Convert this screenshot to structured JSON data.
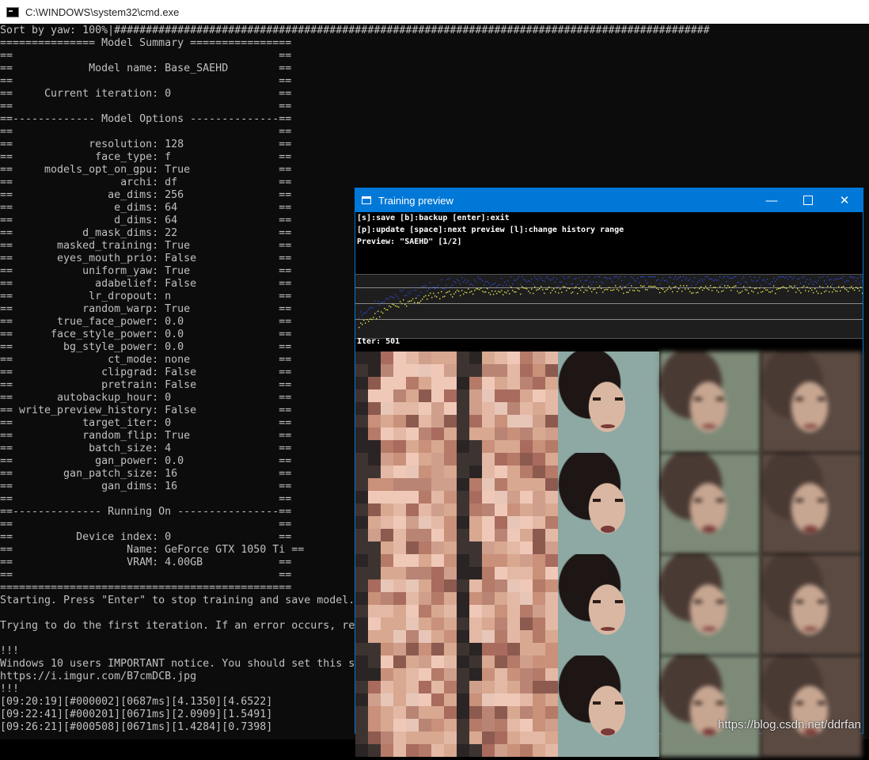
{
  "cmd": {
    "title": "C:\\WINDOWS\\system32\\cmd.exe",
    "lines": [
      "Sort by yaw: 100%|##############################################################################################",
      "=============== Model Summary ================",
      "==                                          ==",
      "==            Model name: Base_SAEHD        ==",
      "==                                          ==",
      "==     Current iteration: 0                 ==",
      "==                                          ==",
      "==------------- Model Options --------------==",
      "==                                          ==",
      "==            resolution: 128               ==",
      "==             face_type: f                 ==",
      "==     models_opt_on_gpu: True              ==",
      "==                 archi: df                ==",
      "==               ae_dims: 256               ==",
      "==                e_dims: 64                ==",
      "==                d_dims: 64                ==",
      "==           d_mask_dims: 22                ==",
      "==       masked_training: True              ==",
      "==       eyes_mouth_prio: False             ==",
      "==           uniform_yaw: True              ==",
      "==             adabelief: False             ==",
      "==            lr_dropout: n                 ==",
      "==           random_warp: True              ==",
      "==       true_face_power: 0.0               ==",
      "==      face_style_power: 0.0               ==",
      "==        bg_style_power: 0.0               ==",
      "==               ct_mode: none              ==",
      "==              clipgrad: False             ==",
      "==              pretrain: False             ==",
      "==       autobackup_hour: 0                 ==",
      "== write_preview_history: False             ==",
      "==           target_iter: 0                 ==",
      "==           random_flip: True              ==",
      "==            batch_size: 4                 ==",
      "==             gan_power: 0.0               ==",
      "==        gan_patch_size: 16                ==",
      "==              gan_dims: 16                ==",
      "==                                          ==",
      "==-------------- Running On ----------------==",
      "==                                          ==",
      "==          Device index: 0                 ==",
      "==                  Name: GeForce GTX 1050 Ti ==",
      "==                  VRAM: 4.00GB            ==",
      "==                                          ==",
      "==============================================",
      "Starting. Press \"Enter\" to stop training and save model.",
      "",
      "Trying to do the first iteration. If an error occurs, re",
      "",
      "!!!",
      "Windows 10 users IMPORTANT notice. You should set this s",
      "https://i.imgur.com/B7cmDCB.jpg",
      "!!!",
      "[09:20:19][#000002][0687ms][4.1350][4.6522]",
      "[09:22:41][#000201][0671ms][2.0909][1.5491]",
      "[09:26:21][#000508][0671ms][1.4284][0.7398]"
    ]
  },
  "preview": {
    "title": "Training preview",
    "hint1": "[s]:save [b]:backup [enter]:exit",
    "hint2": "[p]:update [space]:next preview [l]:change history range",
    "hint3": "Preview: \"SAEHD\" [1/2]",
    "iter": "Iter: 501",
    "controls": {
      "minimize": "—",
      "close": "✕"
    },
    "colors": {
      "loss_src": "#e6e650",
      "loss_dst": "#3050ff",
      "accent": "#0078d7"
    },
    "faces": [
      [
        "pixelated",
        "pixelated",
        "photo",
        "blurred",
        "blurred"
      ],
      [
        "pixelated",
        "pixelated",
        "photo",
        "blurred",
        "blurred"
      ],
      [
        "pixelated",
        "pixelated",
        "photo",
        "blurred",
        "blurred"
      ],
      [
        "pixelated",
        "pixelated",
        "photo",
        "blurred",
        "blurred"
      ]
    ]
  },
  "watermark": "https://blog.csdn.net/ddrfan"
}
